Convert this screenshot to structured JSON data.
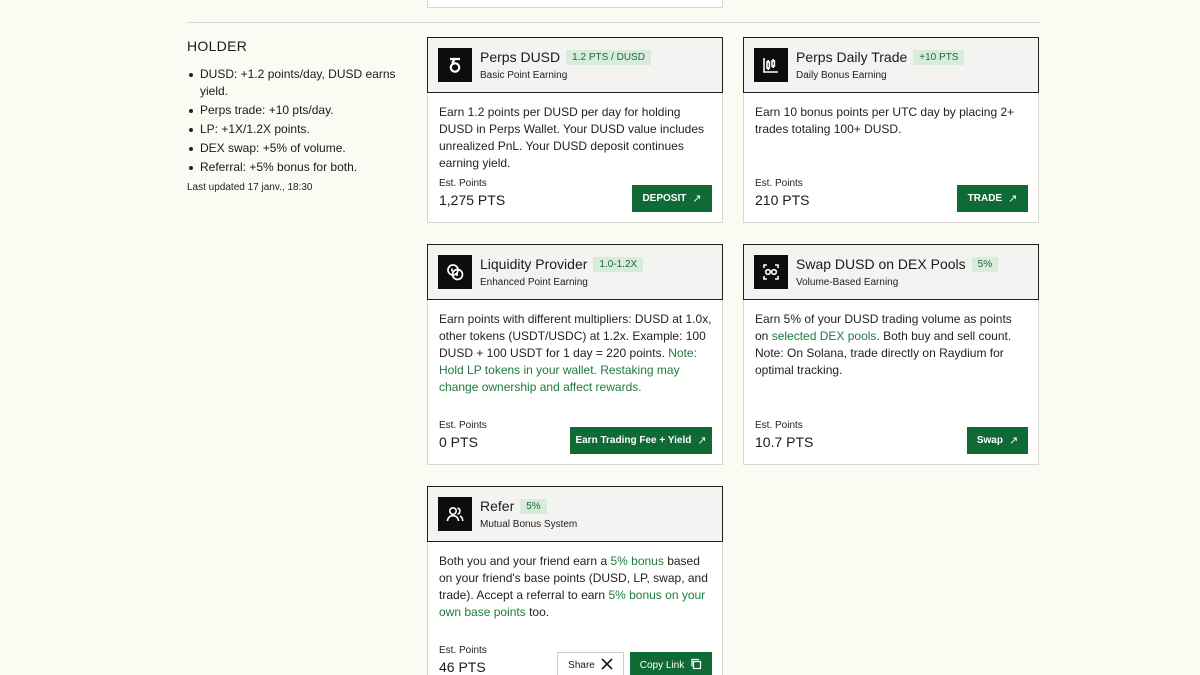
{
  "sidebar": {
    "heading": "HOLDER",
    "items": [
      "DUSD: +1.2 points/day, DUSD earns yield.",
      "Perps trade: +10 pts/day.",
      "LP: +1X/1.2X points.",
      "DEX swap: +5% of volume.",
      "Referral: +5% bonus for both."
    ],
    "updated": "Last updated 17 janv., 18:30"
  },
  "cards": {
    "perps_dusd": {
      "title": "Perps DUSD",
      "badge": "1.2 PTS / DUSD",
      "subtitle": "Basic Point Earning",
      "body": "Earn 1.2 points per DUSD per day for holding DUSD in Perps Wallet. Your DUSD value includes unrealized PnL. Your DUSD deposit continues earning yield.",
      "est_label": "Est. Points",
      "est_value": "1,275 PTS",
      "button": "DEPOSIT",
      "icon": "dusd-logo-icon"
    },
    "perps_daily": {
      "title": "Perps Daily Trade",
      "badge": "+10 PTS",
      "subtitle": "Daily Bonus Earning",
      "body": "Earn 10 bonus points per UTC day by placing 2+ trades totaling 100+ DUSD.",
      "est_label": "Est. Points",
      "est_value": "210 PTS",
      "button": "TRADE",
      "icon": "candlestick-chart-icon"
    },
    "liquidity": {
      "title": "Liquidity Provider",
      "badge": "1.0-1.2X",
      "subtitle": "Enhanced Point Earning",
      "body": "Earn points with different multipliers: DUSD at 1.0x, other tokens (USDT/USDC) at 1.2x. Example: 100 DUSD + 100 USDT for 1 day = 220 points.",
      "note": "Note: Hold LP tokens in your wallet. Restaking may change ownership and affect rewards.",
      "est_label": "Est. Points",
      "est_value": "0 PTS",
      "button": "Earn Trading Fee + Yield",
      "icon": "coins-icon"
    },
    "swap": {
      "title": "Swap DUSD on DEX Pools",
      "badge": "5%",
      "subtitle": "Volume-Based Earning",
      "body_pre": "Earn 5% of your DUSD trading volume as points on",
      "body_link": "selected DEX pools",
      "body_post": ". Both buy and sell count.",
      "body_note": "Note: On Solana, trade directly on Raydium for optimal tracking.",
      "est_label": "Est. Points",
      "est_value": "10.7 PTS",
      "button": "Swap",
      "icon": "swap-icon"
    },
    "refer": {
      "title": "Refer",
      "badge": "5%",
      "subtitle": "Mutual Bonus System",
      "p1": "Both you and your friend earn a",
      "h1": "5% bonus",
      "p2": "based on your friend's base points (DUSD, LP, swap, and trade). Accept a referral to earn",
      "h2": "5% bonus on your own base points",
      "p3": "too.",
      "est_label": "Est. Points",
      "est_value": "46 PTS",
      "share_button": "Share",
      "copy_button": "Copy Link",
      "icon": "users-icon"
    }
  },
  "colors": {
    "accent": "#0f6a36",
    "highlight": "#1e7a3e",
    "badge_bg": "#d8ecdc",
    "page_bg": "#fbfbf4"
  }
}
